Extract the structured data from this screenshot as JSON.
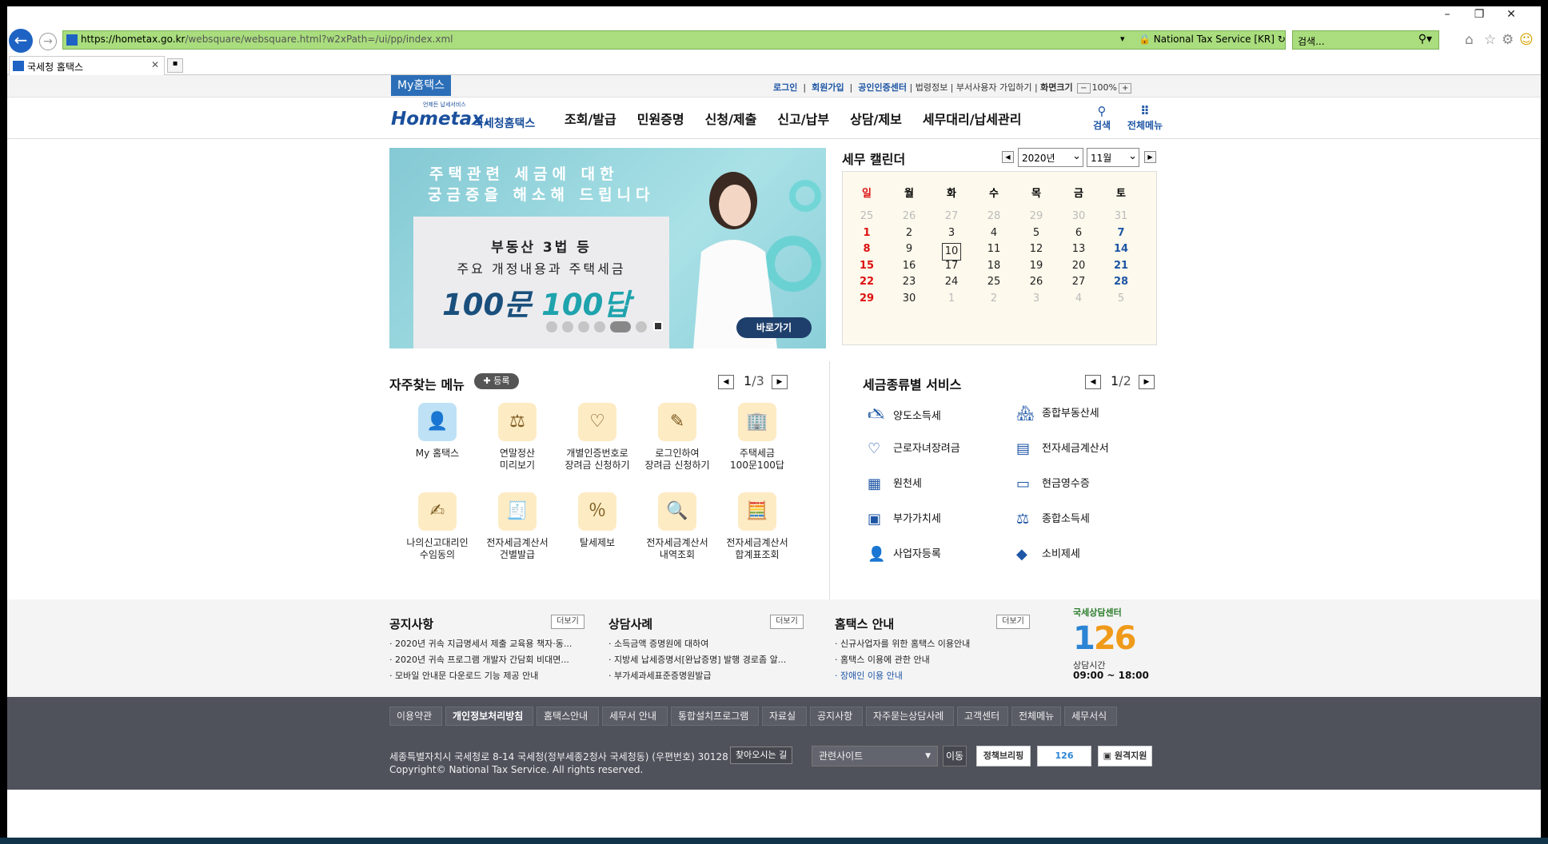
{
  "browser": {
    "url_host": "https://hometax.go.kr",
    "url_path": "/websquare/websquare.html?w2xPath=/ui/pp/index.xml",
    "site_id": "National Tax Service [KR]",
    "search_placeholder": "검색...",
    "tab_title": "국세청 홈택스"
  },
  "util": {
    "my_tab": "My홈택스",
    "login": "로그인",
    "join": "회원가입",
    "cert": "공인인증센터",
    "legal": "법령정보",
    "dept_join": "부서사용자 가입하기",
    "screen_size": "화면크기",
    "zoom": "100%"
  },
  "header": {
    "logo_sub": "언제든 납세서비스",
    "logo_main": "Hometax.",
    "logo_kr": "국세청홈택스",
    "nav": [
      "조회/발급",
      "민원증명",
      "신청/제출",
      "신고/납부",
      "상담/제보",
      "세무대리/납세관리"
    ],
    "search": "검색",
    "all_menu": "전체메뉴"
  },
  "banner": {
    "line1": "주택관련 세금에 대한",
    "line2": "궁금증을 해소해 드립니다",
    "card_l1": "부동산 3법 등",
    "card_l2": "주요 개정내용과 주택세금",
    "card_l3a": "100문",
    "card_l3b": "100답",
    "go": "바로가기"
  },
  "calendar": {
    "title": "세무 캘린더",
    "year": "2020년",
    "month": "11월",
    "weekdays": [
      "일",
      "월",
      "화",
      "수",
      "목",
      "금",
      "토"
    ],
    "weeks": [
      [
        "25",
        "26",
        "27",
        "28",
        "29",
        "30",
        "31"
      ],
      [
        "1",
        "2",
        "3",
        "4",
        "5",
        "6",
        "7"
      ],
      [
        "8",
        "9",
        "10",
        "11",
        "12",
        "13",
        "14"
      ],
      [
        "15",
        "16",
        "17",
        "18",
        "19",
        "20",
        "21"
      ],
      [
        "22",
        "23",
        "24",
        "25",
        "26",
        "27",
        "28"
      ],
      [
        "29",
        "30",
        "1",
        "2",
        "3",
        "4",
        "5"
      ]
    ],
    "today": "10"
  },
  "quick": {
    "title": "자주찾는 메뉴",
    "register": "등록",
    "page_cur": "1",
    "page_total": "/3",
    "items": [
      [
        "My 홈택스",
        ""
      ],
      [
        "연말정산",
        "미리보기"
      ],
      [
        "개별인증번호로",
        "장려금 신청하기"
      ],
      [
        "로그인하여",
        "장려금 신청하기"
      ],
      [
        "주택세금",
        "100문100답"
      ],
      [
        "나의신고대리인",
        "수임동의"
      ],
      [
        "전자세금계산서",
        "건별발급"
      ],
      [
        "탈세제보",
        ""
      ],
      [
        "전자세금계산서",
        "내역조회"
      ],
      [
        "전자세금계산서",
        "합계표조회"
      ]
    ]
  },
  "taxsvc": {
    "title": "세금종류별 서비스",
    "page_cur": "1",
    "page_total": "/2",
    "items": [
      "양도소득세",
      "종합부동산세",
      "근로자녀장려금",
      "전자세금계산서",
      "원천세",
      "현금영수증",
      "부가가치세",
      "종합소득세",
      "사업자등록",
      "소비제세"
    ]
  },
  "notice": {
    "title": "공지사항",
    "more": "더보기",
    "items": [
      "2020년 귀속 지급명세서 제출 교육용 책자·동...",
      "2020년 귀속 프로그램 개발자 간담회 비대면...",
      "모바일 안내문 다운로드 기능 제공 안내"
    ]
  },
  "consult": {
    "title": "상담사례",
    "more": "더보기",
    "items": [
      "소득금액 증명원에 대하여",
      "지방세 납세증명서[완납증명] 발행 경로좀 알...",
      "부가세과세표준증명원발급"
    ]
  },
  "guide": {
    "title": "홈택스 안내",
    "more": "더보기",
    "items": [
      "신규사업자를 위한 홈택스 이용안내",
      "홈택스 이용에 관한 안내",
      "장애인 이용 안내"
    ]
  },
  "center126": {
    "label": "국세상담센터",
    "number_a": "1",
    "number_b": "26",
    "hours_label": "상담시간",
    "hours": "09:00 ~ 18:00"
  },
  "footer": {
    "links": [
      "이용약관",
      "개인정보처리방침",
      "홈택스안내",
      "세무서 안내",
      "통합설치프로그램",
      "자료실",
      "공지사항",
      "자주묻는상담사례",
      "고객센터",
      "전체메뉴",
      "세무서식"
    ],
    "address": "세종특별자치시 국세청로 8-14 국세청(정부세종2청사 국세청동) (우편번호) 30128",
    "find_way": "찾아오시는 길",
    "copyright": "Copyright© National Tax Service. All rights reserved.",
    "related": "관련사이트",
    "go": "이동",
    "banner1": "정책브리핑",
    "banner2": "126",
    "banner3": "원격지원"
  }
}
